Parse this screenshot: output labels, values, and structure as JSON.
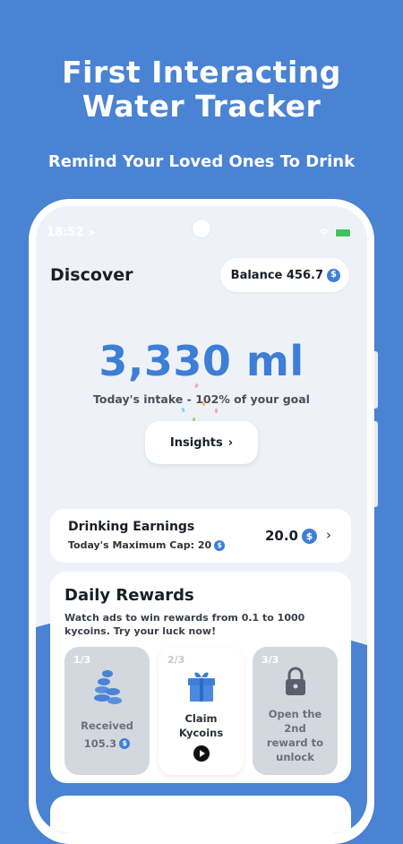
{
  "promo": {
    "title_line1": "First Interacting",
    "title_line2": "Water Tracker",
    "subtitle": "Remind Your Loved Ones To Drink"
  },
  "status_bar": {
    "time": "18:52"
  },
  "header": {
    "title": "Discover",
    "balance_label": "Balance 456.7",
    "coin_symbol": "$"
  },
  "intake": {
    "amount": "3,330 ml",
    "summary": "Today's intake - 102% of your goal",
    "insights_label": "Insights"
  },
  "earnings": {
    "title": "Drinking Earnings",
    "cap_label": "Today's Maximum Cap: 20",
    "value": "20.0"
  },
  "rewards": {
    "title": "Daily Rewards",
    "description": "Watch ads to win rewards from 0.1 to 1000 kycoins. Try your luck now!",
    "tiles": [
      {
        "step": "1/3",
        "label": "Received",
        "amount": "105.3",
        "icon": "coin-stack-icon"
      },
      {
        "step": "2/3",
        "label_line1": "Claim",
        "label_line2": "Kycoins",
        "icon": "gift-icon"
      },
      {
        "step": "3/3",
        "label_line1": "Open the",
        "label_line2": "2nd",
        "label_line3": "reward to",
        "label_line4": "unlock",
        "icon": "lock-icon"
      }
    ]
  },
  "colors": {
    "background": "#4a83d4",
    "accent": "#3d7ed6",
    "card": "#ffffff"
  }
}
